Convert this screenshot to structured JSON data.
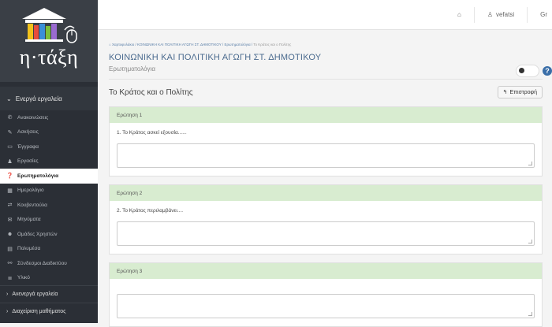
{
  "logo": {
    "text": "η·τάξη"
  },
  "sidebar": {
    "section_active": "Ενεργά εργαλεία",
    "items": [
      {
        "icon": "announcement-icon",
        "glyph": "✆",
        "label": "Ανακοινώσεις",
        "active": false
      },
      {
        "icon": "pencil-icon",
        "glyph": "✎",
        "label": "Ασκήσεις",
        "active": false
      },
      {
        "icon": "folder-icon",
        "glyph": "▭",
        "label": "Έγγραφα",
        "active": false
      },
      {
        "icon": "user-icon",
        "glyph": "♟",
        "label": "Εργασίες",
        "active": false
      },
      {
        "icon": "question-icon",
        "glyph": "❓",
        "label": "Ερωτηματολόγια",
        "active": true
      },
      {
        "icon": "calendar-icon",
        "glyph": "▦",
        "label": "Ημερολόγιο",
        "active": false
      },
      {
        "icon": "exchange-icon",
        "glyph": "⇄",
        "label": "Κουβεντούλα",
        "active": false
      },
      {
        "icon": "envelope-icon",
        "glyph": "✉",
        "label": "Μηνύματα",
        "active": false
      },
      {
        "icon": "users-icon",
        "glyph": "☻",
        "label": "Ομάδες Χρηστών",
        "active": false
      },
      {
        "icon": "table-icon",
        "glyph": "▤",
        "label": "Πολυμέσα",
        "active": false
      },
      {
        "icon": "link-icon",
        "glyph": "⚯",
        "label": "Σύνδεσμοι Διαδικτύου",
        "active": false
      },
      {
        "icon": "list-icon",
        "glyph": "≣",
        "label": "Υλικό",
        "active": false
      }
    ],
    "section_inactive": "Ανενεργά εργαλεία",
    "section_admin": "Διαχείριση μαθήματος"
  },
  "topbar": {
    "home_icon": "home-icon",
    "user_name": "vefatsi",
    "extra": "Gr"
  },
  "breadcrumb": {
    "home": "Χαρτοφυλάκιο",
    "course": "ΚΟΙΝΩΝΙΚΗ ΚΑΙ ΠΟΛΙΤΙΚΗ ΑΓΩΓΗ ΣΤ. ΔΗΜΟΤΙΚΟΥ",
    "section": "Ερωτηματολόγια",
    "current": "Το Κράτος και ο Πολίτης"
  },
  "page": {
    "title": "ΚΟΙΝΩΝΙΚΗ ΚΑΙ ΠΟΛΙΤΙΚΗ ΑΓΩΓΗ ΣΤ. ΔΗΜΟΤΙΚΟΥ",
    "subtitle": "Ερωτηματολόγια",
    "section_title": "Το Κράτος και ο Πολίτης",
    "back_label": "Επιστροφή"
  },
  "questions": [
    {
      "header": "Ερώτηση 1",
      "text": "1. Το Κράτος ασκεί εξουσία......",
      "answer": ""
    },
    {
      "header": "Ερώτηση 2",
      "text": "2. Το Κράτος περιλαμβάνει....",
      "answer": ""
    },
    {
      "header": "Ερώτηση 3",
      "text": "",
      "answer": ""
    }
  ]
}
